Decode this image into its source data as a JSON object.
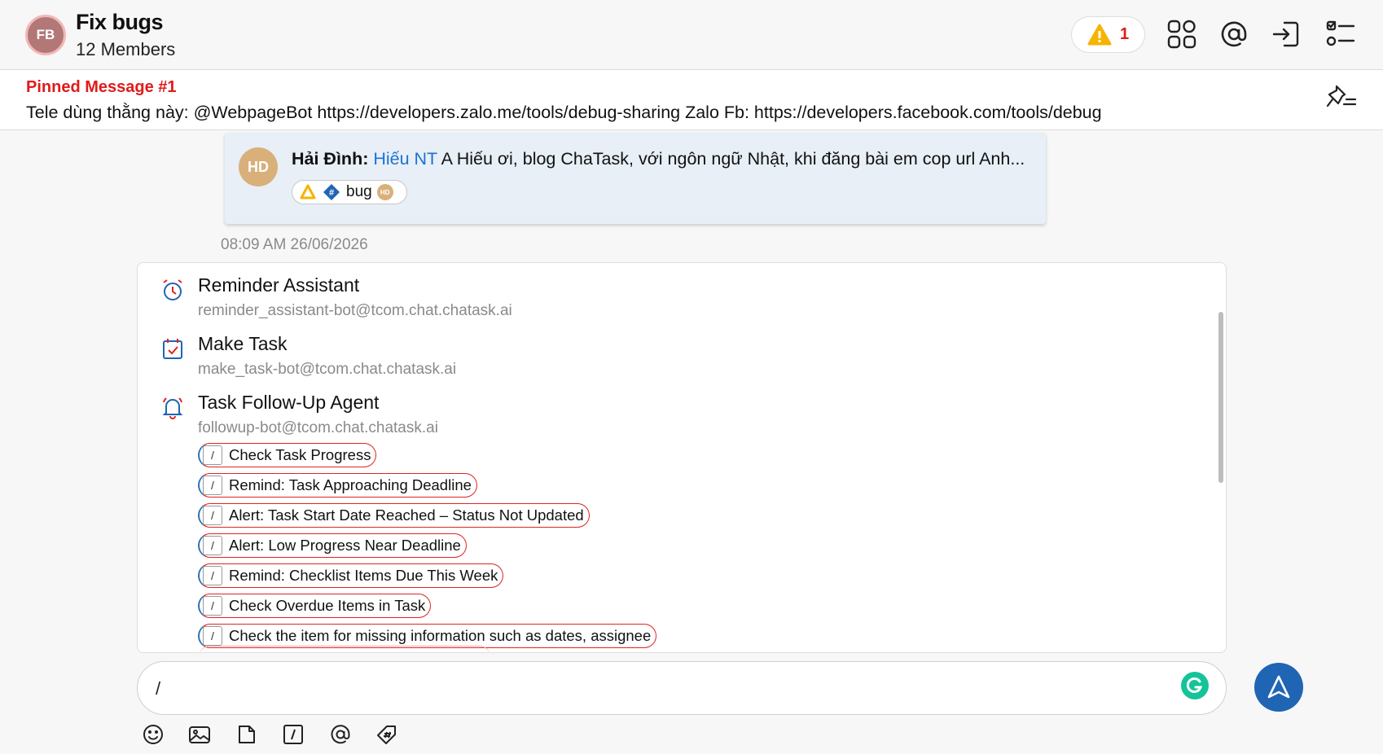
{
  "header": {
    "avatar_initials": "FB",
    "title": "Fix bugs",
    "members": "12 Members",
    "alert_count": "1",
    "icons": [
      "warning-icon",
      "apps-grid-icon",
      "at-mention-icon",
      "login-icon",
      "checklist-icon"
    ]
  },
  "pinned": {
    "label": "Pinned Message #1",
    "text": "Tele dùng thằng này: @WebpageBot https://developers.zalo.me/tools/debug-sharing Zalo Fb: https://developers.facebook.com/tools/debug"
  },
  "quote": {
    "avatar_initials": "HD",
    "sender": "Hải Đình:",
    "mention": "Hiếu NT",
    "text": " A Hiếu ơi, blog ChaTask, với ngôn ngữ Nhật, khi đăng bài em cop url Anh...",
    "tag_label": "bug",
    "tag_avatar": "HD"
  },
  "timestamp": "08:09 AM 26/06/2026",
  "bots": [
    {
      "name": "Reminder Assistant",
      "email": "reminder_assistant-bot@tcom.chat.chatask.ai",
      "icon": "alarm-clock-icon"
    },
    {
      "name": "Make Task",
      "email": "make_task-bot@tcom.chat.chatask.ai",
      "icon": "calendar-check-icon"
    },
    {
      "name": "Task Follow-Up Agent",
      "email": "followup-bot@tcom.chat.chatask.ai",
      "icon": "bell-icon"
    }
  ],
  "commands": [
    "Check Task Progress",
    "Remind: Task Approaching Deadline",
    "Alert: Task Start Date Reached – Status Not Updated",
    "Alert: Low Progress Near Deadline",
    "Remind: Checklist Items Due This Week",
    "Check Overdue Items in Task",
    "Check the item for missing information such as dates, assignee"
  ],
  "command_slash": "/",
  "composer": {
    "value": "/"
  },
  "toolbar_icons": [
    "emoji-icon",
    "image-icon",
    "file-icon",
    "slash-command-icon",
    "mention-icon",
    "tag-icon"
  ],
  "colors": {
    "accent": "#1f65b3",
    "alert": "#e01b1b",
    "mention": "#1b73d4"
  }
}
